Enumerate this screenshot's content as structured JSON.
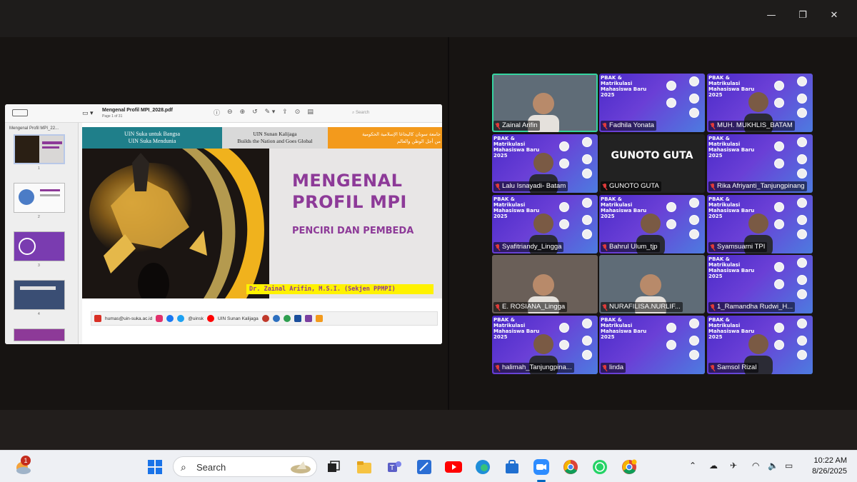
{
  "window": {
    "minimize_glyph": "—",
    "restore_glyph": "❐",
    "close_glyph": "✕"
  },
  "pdf": {
    "file_title": "Mengenal Profil MPI_2028.pdf",
    "page_info": "Page 1 of 31",
    "search_placeholder": "Search",
    "sidebar_title": "Mengenal Profil MPI_22...",
    "thumb_numbers": [
      "1",
      "2",
      "3",
      "4"
    ]
  },
  "slide": {
    "banner_left": [
      "UIN Suka untuk Bangsa",
      "UIN Suka Mendunia"
    ],
    "banner_mid": [
      "UIN Sunan Kalijaga",
      "Builds the Nation and Goes Global"
    ],
    "banner_right": [
      "جامعة سونان كاليجاغا الإسلامية الحكومية",
      "من أجل الوطن والعالم"
    ],
    "title": "MENGENAL PROFIL MPI",
    "subtitle": "PENCIRI DAN PEMBEDA",
    "author": "Dr. Zainal Arifin, M.S.I. (Sekjen PPMPI)",
    "footer_email": "humas@uin-suka.ac.id",
    "footer_social": "@uinsk",
    "footer_youtube": "UIN Sunan Kalijaga"
  },
  "participants": [
    {
      "name": "Zainal Arifin",
      "kind": "cam",
      "active": true
    },
    {
      "name": "Fadhila Yonata",
      "kind": "bg"
    },
    {
      "name": "MUH. MUKHLIS_BATAM",
      "kind": "bg"
    },
    {
      "name": "Lalu Isnayadi- Batam",
      "kind": "bg"
    },
    {
      "name": "GUNOTO GUTA",
      "kind": "dark",
      "display": "GUNOTO GUTA"
    },
    {
      "name": "Rika Afriyanti_Tanjungpinang",
      "kind": "bg"
    },
    {
      "name": "Syafitriandy_Lingga",
      "kind": "bg"
    },
    {
      "name": "Bahrul Ulum_tjp",
      "kind": "bg"
    },
    {
      "name": "Syamsuarni TPI",
      "kind": "bg"
    },
    {
      "name": "E. ROSIANA_Lingga",
      "kind": "cam"
    },
    {
      "name": "NURAFILISA.NURLIF...",
      "kind": "cam"
    },
    {
      "name": "1_Ramandha Rudwi_H...",
      "kind": "bg"
    },
    {
      "name": "halimah_Tanjungpina...",
      "kind": "bg"
    },
    {
      "name": "linda",
      "kind": "bg"
    },
    {
      "name": "Samsol Rizal",
      "kind": "bg"
    }
  ],
  "card_text": [
    "PBAK & Matrikulasi",
    "Mahasiswa Baru 2025"
  ],
  "taskbar": {
    "search_label": "Search",
    "weather_badge": "1",
    "time": "10:22 AM",
    "date": "8/26/2025"
  },
  "colors": {
    "accent_purple": "#8d3a98",
    "active_speaker": "#35d4a0",
    "tile_bg": "#5a34d0"
  }
}
